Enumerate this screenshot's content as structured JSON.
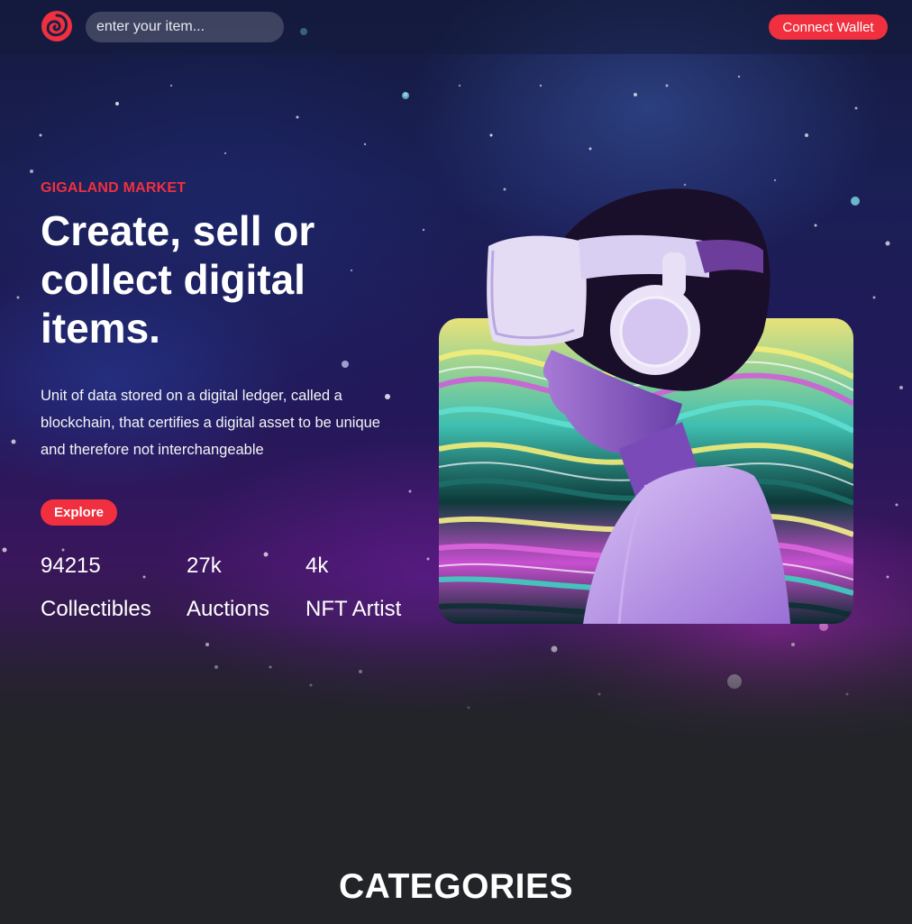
{
  "header": {
    "search_placeholder": "enter your item...",
    "connect_label": "Connect Wallet",
    "logo_icon": "spiral-logo-icon",
    "accent_color": "#f0303f"
  },
  "hero": {
    "eyebrow": "GIGALAND MARKET",
    "headline": "Create, sell or collect digital items.",
    "description": "Unit of data stored on a digital ledger, called a blockchain, that certifies a digital asset to be unique and therefore not interchangeable",
    "explore_label": "Explore",
    "stats": [
      {
        "value": "94215",
        "label": "Collectibles"
      },
      {
        "value": "27k",
        "label": "Auctions"
      },
      {
        "value": "4k",
        "label": "NFT Artist"
      }
    ]
  },
  "categories": {
    "title": "CATEGORIES"
  }
}
